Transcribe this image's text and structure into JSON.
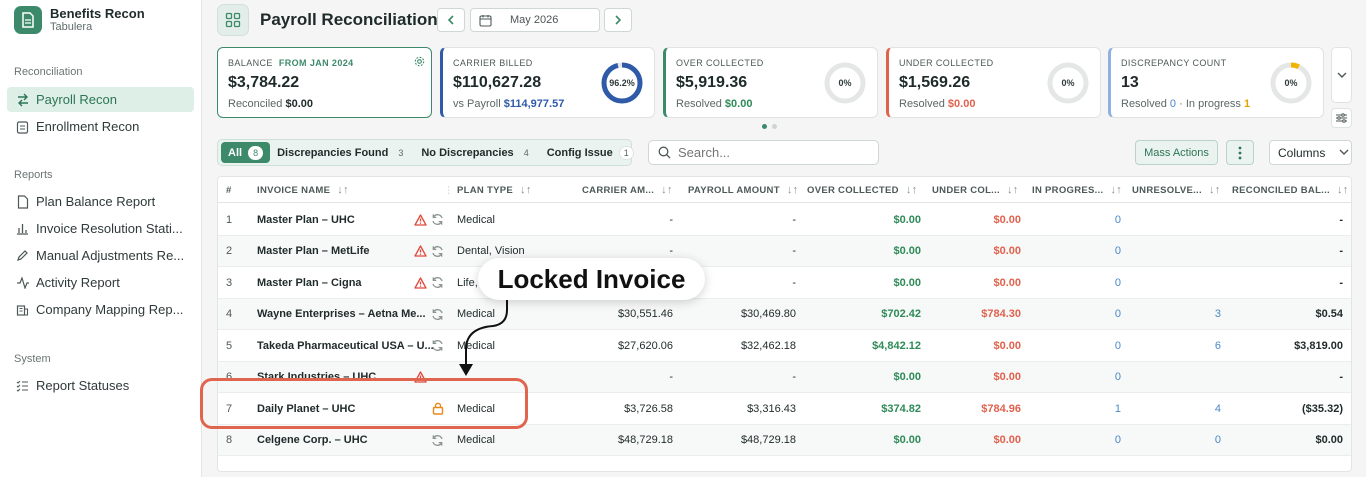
{
  "brand": {
    "title": "Benefits Recon",
    "subtitle": "Tabulera"
  },
  "sidebar": {
    "sections": [
      {
        "label": "Reconciliation"
      },
      {
        "label": "Reports"
      },
      {
        "label": "System"
      }
    ],
    "items": [
      {
        "label": "Payroll Recon",
        "icon": "arrows-swap-icon",
        "active": true
      },
      {
        "label": "Enrollment Recon",
        "icon": "clipboard-icon"
      },
      {
        "label": "Plan Balance Report",
        "icon": "document-icon"
      },
      {
        "label": "Invoice Resolution Stati...",
        "icon": "bar-chart-icon"
      },
      {
        "label": "Manual Adjustments Re...",
        "icon": "pen-icon"
      },
      {
        "label": "Activity Report",
        "icon": "activity-icon"
      },
      {
        "label": "Company Mapping Rep...",
        "icon": "building-icon"
      },
      {
        "label": "Report Statuses",
        "icon": "checklist-icon"
      }
    ]
  },
  "header": {
    "title": "Payroll Reconciliation",
    "period": "May 2026"
  },
  "cards": {
    "balance": {
      "label": "Balance",
      "tag": "From Jan 2024",
      "value": "$3,784.22",
      "sub_label": "Reconciled",
      "sub_value": "$0.00"
    },
    "carrier": {
      "label": "Carrier Billed",
      "value": "$110,627.28",
      "sub_label": "vs Payroll",
      "sub_value": "$114,977.57",
      "ring": "96.2%",
      "ring_value": 96.2
    },
    "over": {
      "label": "Over Collected",
      "value": "$5,919.36",
      "sub_label": "Resolved",
      "sub_value": "$0.00",
      "ring": "0%"
    },
    "under": {
      "label": "Under Collected",
      "value": "$1,569.26",
      "sub_label": "Resolved",
      "sub_value": "$0.00",
      "ring": "0%"
    },
    "count": {
      "label": "Discrepancy Count",
      "value": "13",
      "sub_label": "Resolved",
      "sub_value": "0",
      "sub_sep": "·",
      "sub_label2": "In progress",
      "sub_value2": "1",
      "ring": "0%"
    }
  },
  "filters": [
    {
      "label": "All",
      "count": "8",
      "active": true
    },
    {
      "label": "Discrepancies Found",
      "count": "3"
    },
    {
      "label": "No Discrepancies",
      "count": "4"
    },
    {
      "label": "Config Issue",
      "count": "1"
    }
  ],
  "search": {
    "placeholder": "Search..."
  },
  "actions": {
    "mass": "Mass Actions",
    "columns": "Columns"
  },
  "table": {
    "headers": [
      "#",
      "INVOICE NAME",
      "PLAN TYPE",
      "CARRIER AM...",
      "PAYROLL AMOUNT",
      "OVER COLLECTED",
      "UNDER COL...",
      "IN PROGRES...",
      "UNRESOLVE...",
      "RECONCILED BAL..."
    ],
    "rows": [
      {
        "n": "1",
        "name": "Master Plan – UHC",
        "warn": true,
        "sync": true,
        "lock": false,
        "plan": "Medical",
        "carrier": "-",
        "payroll": "-",
        "over": "$0.00",
        "under": "$0.00",
        "inprog": "0",
        "unres": "",
        "recon": "-"
      },
      {
        "n": "2",
        "name": "Master Plan – MetLife",
        "warn": true,
        "sync": true,
        "lock": false,
        "plan": "Dental, Vision",
        "carrier": "-",
        "payroll": "-",
        "over": "$0.00",
        "under": "$0.00",
        "inprog": "0",
        "unres": "",
        "recon": "-"
      },
      {
        "n": "3",
        "name": "Master Plan – Cigna",
        "warn": true,
        "sync": true,
        "lock": false,
        "plan": "Life,",
        "carrier": "-",
        "payroll": "-",
        "over": "$0.00",
        "under": "$0.00",
        "inprog": "0",
        "unres": "",
        "recon": "-"
      },
      {
        "n": "4",
        "name": "Wayne Enterprises – Aetna Me...",
        "warn": false,
        "sync": true,
        "lock": false,
        "plan": "Medical",
        "carrier": "$30,551.46",
        "payroll": "$30,469.80",
        "over": "$702.42",
        "under": "$784.30",
        "inprog": "0",
        "unres": "3",
        "recon": "$0.54"
      },
      {
        "n": "5",
        "name": "Takeda Pharmaceutical USA – U...",
        "warn": false,
        "sync": true,
        "lock": false,
        "plan": "Medical",
        "carrier": "$27,620.06",
        "payroll": "$32,462.18",
        "over": "$4,842.12",
        "under": "$0.00",
        "inprog": "0",
        "unres": "6",
        "recon": "$3,819.00"
      },
      {
        "n": "6",
        "name": "Stark Industries – UHC",
        "warn": true,
        "sync": false,
        "lock": false,
        "plan": "",
        "carrier": "-",
        "payroll": "-",
        "over": "$0.00",
        "under": "$0.00",
        "inprog": "0",
        "unres": "",
        "recon": "-"
      },
      {
        "n": "7",
        "name": "Daily Planet – UHC",
        "warn": false,
        "sync": false,
        "lock": true,
        "plan": "Medical",
        "carrier": "$3,726.58",
        "payroll": "$3,316.43",
        "over": "$374.82",
        "under": "$784.96",
        "inprog": "1",
        "unres": "4",
        "recon": "($35.32)"
      },
      {
        "n": "8",
        "name": "Celgene Corp. – UHC",
        "warn": false,
        "sync": true,
        "lock": false,
        "plan": "Medical",
        "carrier": "$48,729.18",
        "payroll": "$48,729.18",
        "over": "$0.00",
        "under": "$0.00",
        "inprog": "0",
        "unres": "0",
        "recon": "$0.00"
      }
    ]
  },
  "annotation": {
    "callout": "Locked Invoice"
  },
  "colors": {
    "accent": "#3d8a6b",
    "positive": "#2e8b57",
    "negative": "#e0624d",
    "link": "#4a88c7",
    "highlight": "#e0654f",
    "ring_fill": "#2f5aa8",
    "ring_warn": "#f0b400"
  }
}
